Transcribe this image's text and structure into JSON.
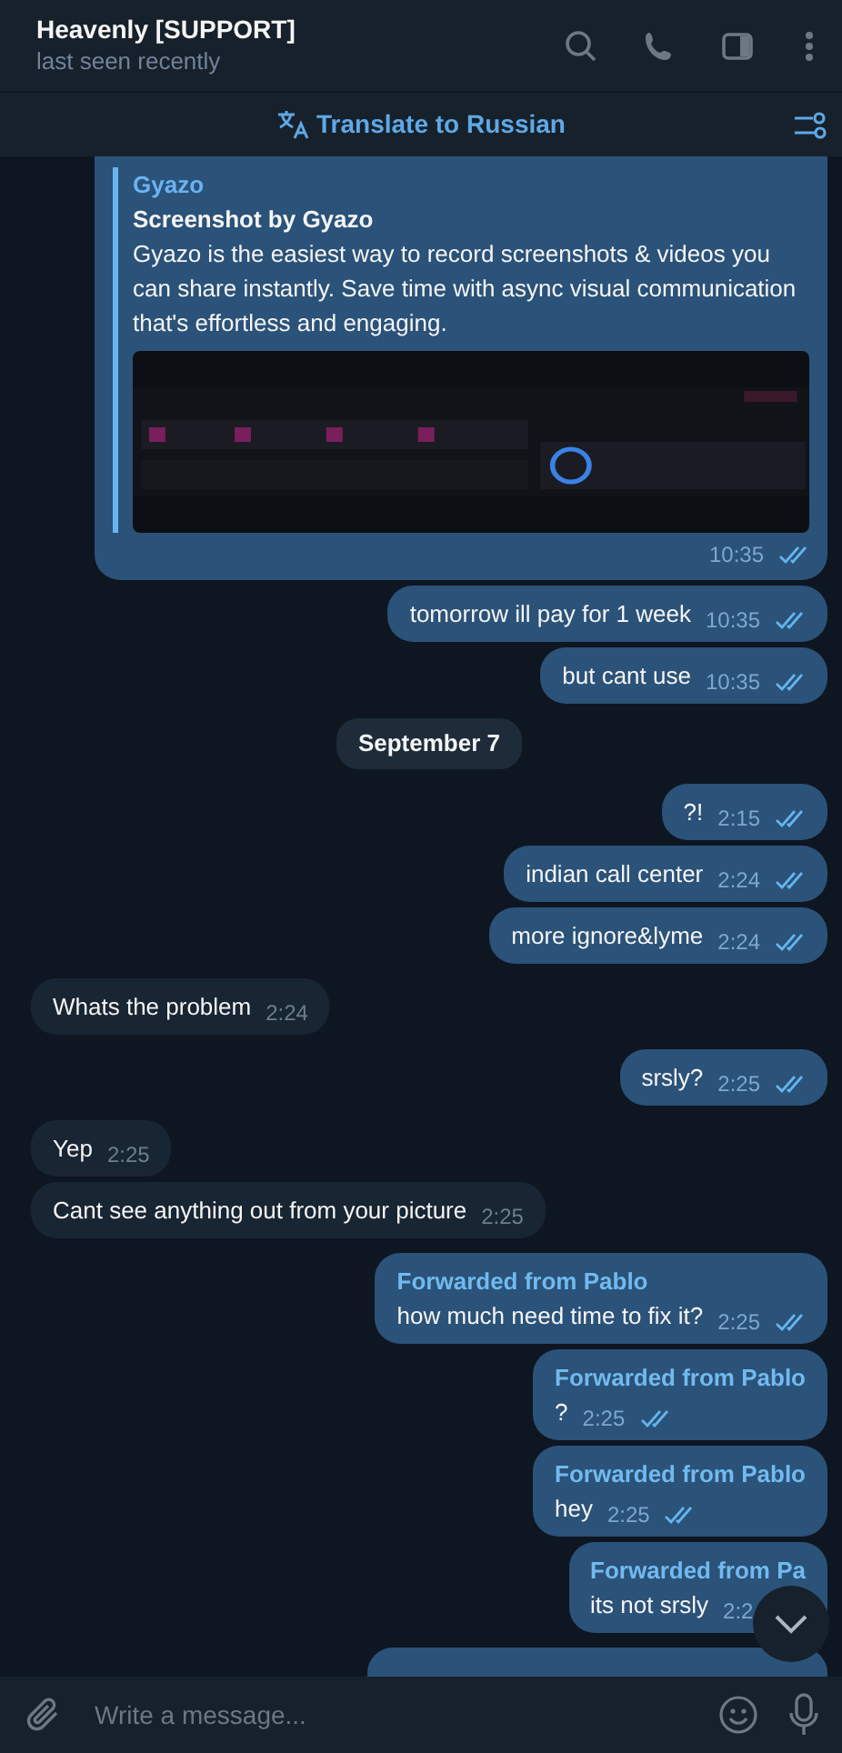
{
  "header": {
    "title": "Heavenly [SUPPORT]",
    "status": "last seen recently"
  },
  "translate_bar": {
    "label": "Translate to Russian"
  },
  "messages": [
    {
      "kind": "link_preview",
      "site": "Gyazo",
      "title": "Screenshot by Gyazo",
      "description": "Gyazo is the easiest way to record screenshots & videos you can share instantly. Save time with async visual communication that's effortless and engaging.",
      "time": "10:35",
      "read": true
    },
    {
      "kind": "out",
      "text": "tomorrow ill pay for 1 week",
      "time": "10:35",
      "read": true
    },
    {
      "kind": "out",
      "text": "but cant use",
      "time": "10:35",
      "read": true
    },
    {
      "kind": "date",
      "text": "September 7"
    },
    {
      "kind": "out",
      "text": "?!",
      "time": "2:15",
      "read": true
    },
    {
      "kind": "out",
      "text": "indian call center",
      "time": "2:24",
      "read": true
    },
    {
      "kind": "out",
      "text": "more ignore&lyme",
      "time": "2:24",
      "read": true
    },
    {
      "kind": "in",
      "text": "Whats the problem",
      "time": "2:24"
    },
    {
      "kind": "out",
      "text": "srsly?",
      "time": "2:25",
      "read": true
    },
    {
      "kind": "in",
      "text": "Yep",
      "time": "2:25"
    },
    {
      "kind": "in",
      "text": "Cant see anything out from your picture",
      "time": "2:25"
    },
    {
      "kind": "out",
      "forwarded": "Forwarded from Pablo",
      "text": "how much need time to fix it?",
      "time": "2:25",
      "read": true
    },
    {
      "kind": "out",
      "forwarded": "Forwarded from Pablo",
      "text": "?",
      "time": "2:25",
      "read": true
    },
    {
      "kind": "out",
      "forwarded": "Forwarded from Pablo",
      "text": "hey",
      "time": "2:25",
      "read": true
    },
    {
      "kind": "out",
      "forwarded": "Forwarded from Pa",
      "text": "its not srsly",
      "time": "2:2"
    },
    {
      "kind": "stub"
    }
  ],
  "composer": {
    "placeholder": "Write a message..."
  }
}
